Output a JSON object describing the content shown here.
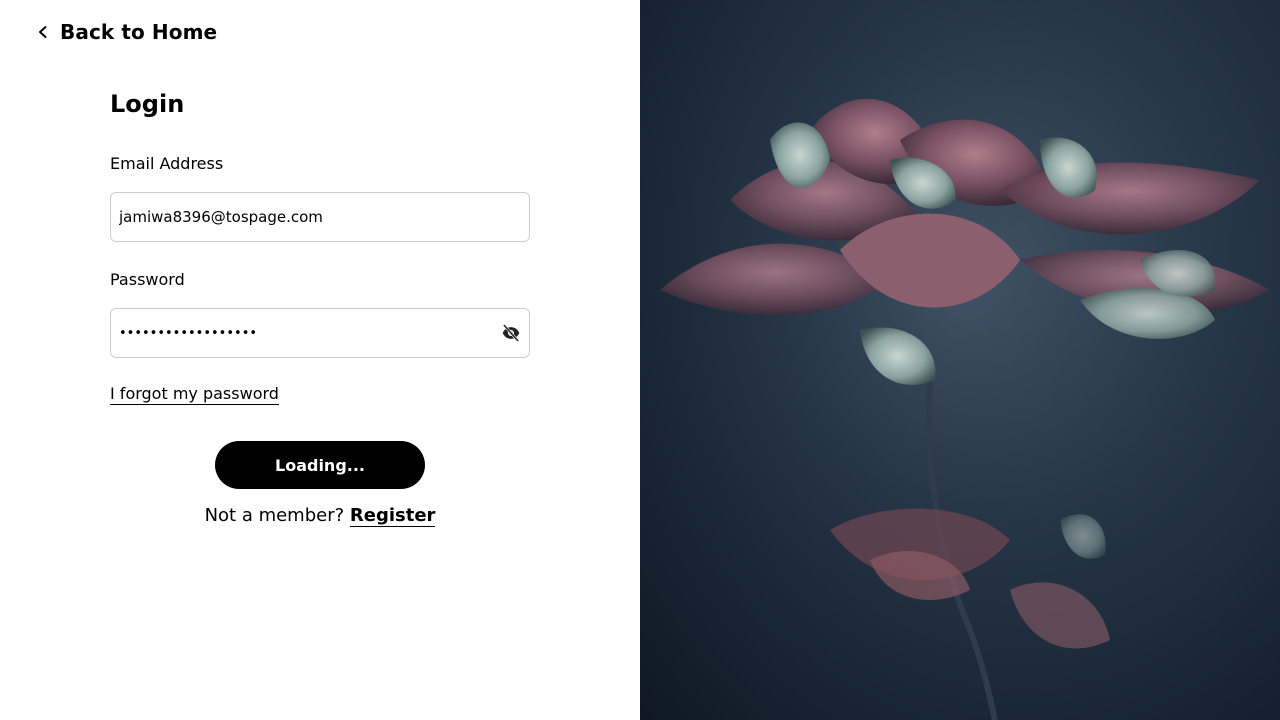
{
  "nav": {
    "back_label": "Back to Home"
  },
  "login": {
    "title": "Login",
    "email": {
      "label": "Email Address",
      "value": "jamiwa8396@tospage.com"
    },
    "password": {
      "label": "Password",
      "value": "••••••••••••••••••"
    },
    "forgot_label": "I forgot my password",
    "submit_label": "Loading...",
    "register_prompt": "Not a member?",
    "register_label": "Register"
  },
  "icons": {
    "back": "chevron-left-icon",
    "toggle_password": "eye-off-icon"
  },
  "colors": {
    "button_bg": "#000000",
    "button_text": "#ffffff",
    "input_border": "#cfcfcf",
    "hero_bg": "#1b2736"
  }
}
